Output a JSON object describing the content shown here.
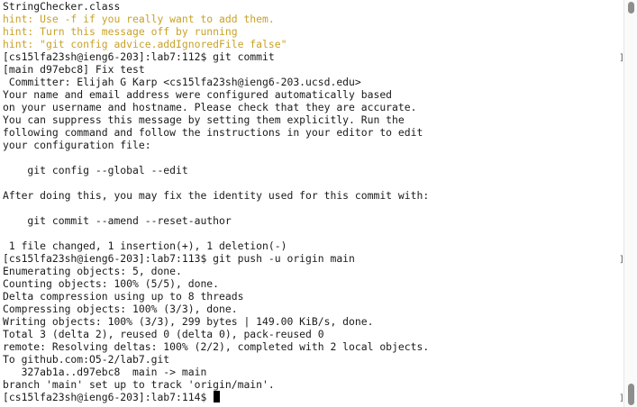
{
  "terminal": {
    "lines": [
      {
        "text": "StringChecker.class",
        "kind": "normal"
      },
      {
        "text": "hint: Use -f if you really want to add them.",
        "kind": "hint"
      },
      {
        "text": "hint: Turn this message off by running",
        "kind": "hint"
      },
      {
        "text": "hint: \"git config advice.addIgnoredFile false\"",
        "kind": "hint"
      },
      {
        "text": "[cs15lfa23sh@ieng6-203]:lab7:112$ git commit",
        "kind": "prompt"
      },
      {
        "text": "[main d97ebc8] Fix test",
        "kind": "normal"
      },
      {
        "text": " Committer: Elijah G Karp <cs15lfa23sh@ieng6-203.ucsd.edu>",
        "kind": "normal"
      },
      {
        "text": "Your name and email address were configured automatically based",
        "kind": "normal"
      },
      {
        "text": "on your username and hostname. Please check that they are accurate.",
        "kind": "normal"
      },
      {
        "text": "You can suppress this message by setting them explicitly. Run the",
        "kind": "normal"
      },
      {
        "text": "following command and follow the instructions in your editor to edit",
        "kind": "normal"
      },
      {
        "text": "your configuration file:",
        "kind": "normal"
      },
      {
        "text": "",
        "kind": "normal"
      },
      {
        "text": "    git config --global --edit",
        "kind": "normal"
      },
      {
        "text": "",
        "kind": "normal"
      },
      {
        "text": "After doing this, you may fix the identity used for this commit with:",
        "kind": "normal"
      },
      {
        "text": "",
        "kind": "normal"
      },
      {
        "text": "    git commit --amend --reset-author",
        "kind": "normal"
      },
      {
        "text": "",
        "kind": "normal"
      },
      {
        "text": " 1 file changed, 1 insertion(+), 1 deletion(-)",
        "kind": "normal"
      },
      {
        "text": "[cs15lfa23sh@ieng6-203]:lab7:113$ git push -u origin main",
        "kind": "prompt"
      },
      {
        "text": "Enumerating objects: 5, done.",
        "kind": "normal"
      },
      {
        "text": "Counting objects: 100% (5/5), done.",
        "kind": "normal"
      },
      {
        "text": "Delta compression using up to 8 threads",
        "kind": "normal"
      },
      {
        "text": "Compressing objects: 100% (3/3), done.",
        "kind": "normal"
      },
      {
        "text": "Writing objects: 100% (3/3), 299 bytes | 149.00 KiB/s, done.",
        "kind": "normal"
      },
      {
        "text": "Total 3 (delta 2), reused 0 (delta 0), pack-reused 0",
        "kind": "normal"
      },
      {
        "text": "remote: Resolving deltas: 100% (2/2), completed with 2 local objects.",
        "kind": "normal"
      },
      {
        "text": "To github.com:O5-2/lab7.git",
        "kind": "normal"
      },
      {
        "text": "   327ab1a..d97ebc8  main -> main",
        "kind": "normal"
      },
      {
        "text": "branch 'main' set up to track 'origin/main'.",
        "kind": "normal"
      },
      {
        "text": "[cs15lfa23sh@ieng6-203]:lab7:114$ ",
        "kind": "current-prompt"
      }
    ],
    "hint_color": "#c9a227",
    "text_color": "#1a1a1a",
    "background_color": "#ffffff"
  },
  "scrollbar": {
    "thumb_color": "#8e8e8e"
  }
}
